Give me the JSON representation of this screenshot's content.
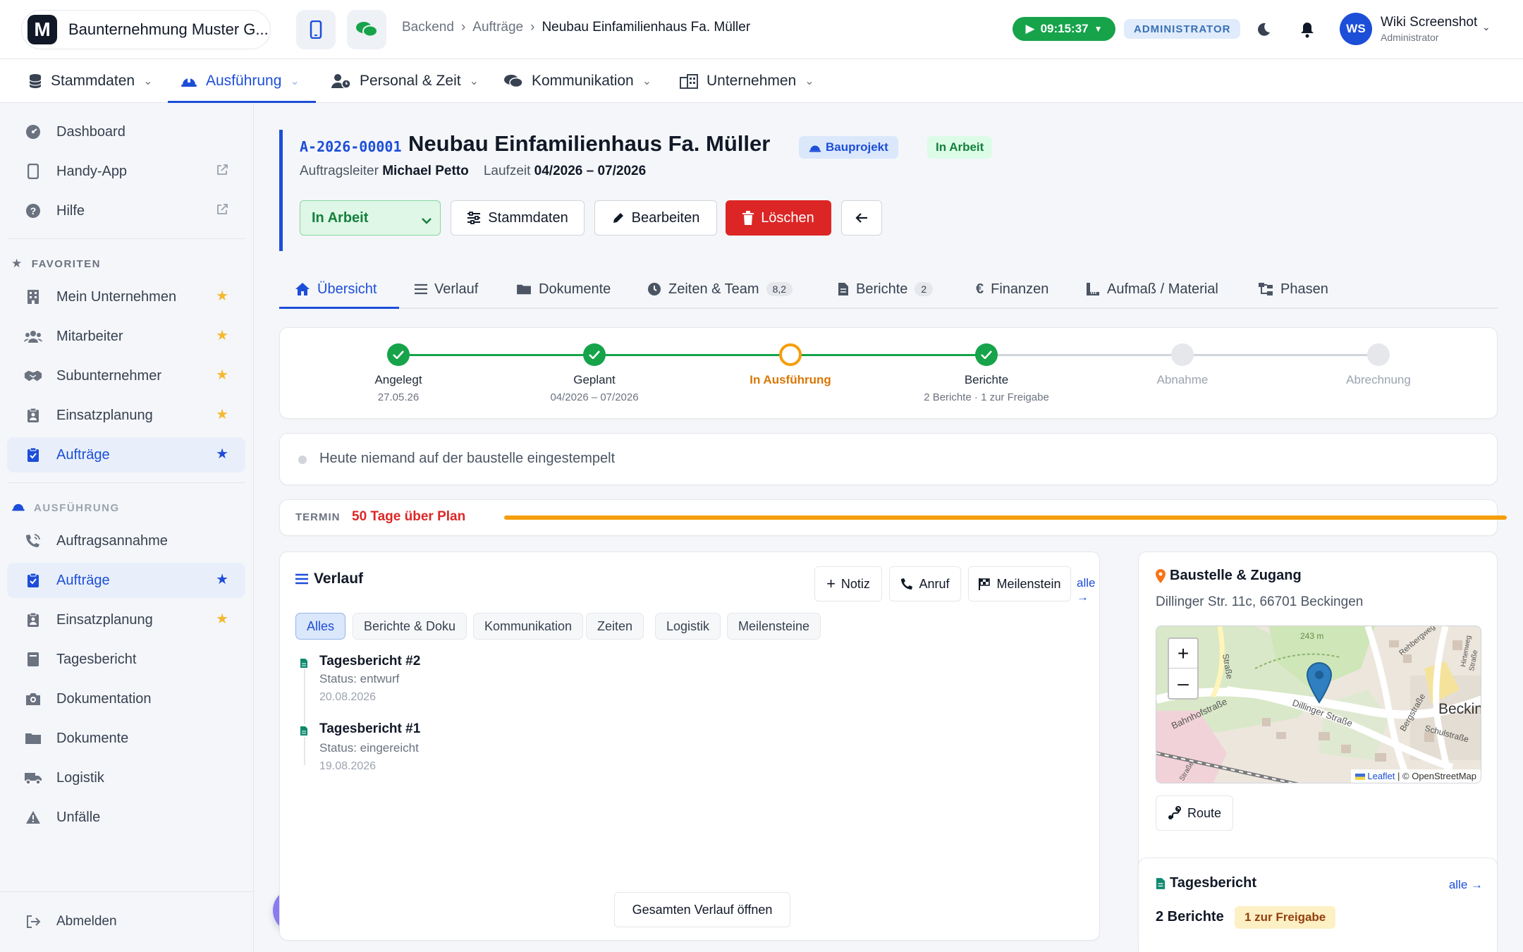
{
  "header": {
    "company_logo": "M",
    "company_name": "Baunternehmung Muster G...",
    "breadcrumb": [
      "Backend",
      "Aufträge",
      "Neubau Einfamilienhaus Fa. Müller"
    ],
    "timer": "09:15:37",
    "role": "ADMINISTRATOR",
    "user_initials": "WS",
    "user_name": "Wiki Screenshot",
    "user_role": "Administrator"
  },
  "mainnav": [
    {
      "label": "Stammdaten",
      "icon": "database-icon"
    },
    {
      "label": "Ausführung",
      "icon": "hardhat-icon",
      "active": true
    },
    {
      "label": "Personal & Zeit",
      "icon": "user-clock-icon"
    },
    {
      "label": "Kommunikation",
      "icon": "comments-icon"
    },
    {
      "label": "Unternehmen",
      "icon": "building-icon"
    }
  ],
  "sidebar": {
    "top": [
      {
        "label": "Dashboard",
        "icon": "gauge-icon"
      },
      {
        "label": "Handy-App",
        "icon": "phone-icon",
        "external": true
      },
      {
        "label": "Hilfe",
        "icon": "help-icon",
        "external": true
      }
    ],
    "favorites_title": "FAVORITEN",
    "favorites": [
      {
        "label": "Mein Unternehmen",
        "icon": "building-icon"
      },
      {
        "label": "Mitarbeiter",
        "icon": "users-icon"
      },
      {
        "label": "Subunternehmer",
        "icon": "handshake-icon"
      },
      {
        "label": "Einsatzplanung",
        "icon": "clipboard-icon"
      },
      {
        "label": "Aufträge",
        "icon": "clipboard-check-icon",
        "active": true
      }
    ],
    "execution_title": "AUSFÜHRUNG",
    "execution": [
      {
        "label": "Auftragsannahme",
        "icon": "phone-volume-icon"
      },
      {
        "label": "Aufträge",
        "icon": "clipboard-check-icon",
        "active": true,
        "star": true
      },
      {
        "label": "Einsatzplanung",
        "icon": "clipboard-icon",
        "star": true
      },
      {
        "label": "Tagesbericht",
        "icon": "book-icon"
      },
      {
        "label": "Dokumentation",
        "icon": "camera-icon"
      },
      {
        "label": "Dokumente",
        "icon": "folder-icon"
      },
      {
        "label": "Logistik",
        "icon": "truck-icon"
      },
      {
        "label": "Unfälle",
        "icon": "warning-icon"
      }
    ],
    "logout": "Abmelden"
  },
  "order": {
    "number": "A-2026-00001",
    "title": "Neubau Einfamilienhaus Fa. Müller",
    "type_badge": "Bauprojekt",
    "status_badge": "In Arbeit",
    "leader_label": "Auftragsleiter",
    "leader": "Michael Petto",
    "duration_label": "Laufzeit",
    "duration": "04/2026 – 07/2026",
    "status_select": "In Arbeit",
    "btn_master": "Stammdaten",
    "btn_edit": "Bearbeiten",
    "btn_delete": "Löschen"
  },
  "tabs": [
    {
      "label": "Übersicht",
      "icon": "home-icon",
      "active": true
    },
    {
      "label": "Verlauf",
      "icon": "list-icon"
    },
    {
      "label": "Dokumente",
      "icon": "folder-icon"
    },
    {
      "label": "Zeiten & Team",
      "icon": "clock-icon",
      "count": "8,2"
    },
    {
      "label": "Berichte",
      "icon": "file-icon",
      "count": "2"
    },
    {
      "label": "Finanzen",
      "icon": "euro-icon"
    },
    {
      "label": "Aufmaß / Material",
      "icon": "ruler-icon"
    },
    {
      "label": "Phasen",
      "icon": "sitemap-icon"
    }
  ],
  "progress": [
    {
      "label": "Angelegt",
      "sub": "27.05.26",
      "state": "done"
    },
    {
      "label": "Geplant",
      "sub": "04/2026 – 07/2026",
      "state": "done"
    },
    {
      "label": "In Ausführung",
      "sub": "",
      "state": "current"
    },
    {
      "label": "Berichte",
      "sub": "2 Berichte · 1 zur Freigabe",
      "state": "done"
    },
    {
      "label": "Abnahme",
      "sub": "",
      "state": "pending"
    },
    {
      "label": "Abrechnung",
      "sub": "",
      "state": "pending"
    }
  ],
  "clockin": "Heute niemand auf der baustelle eingestempelt",
  "termin": {
    "label": "TERMIN",
    "text": "50 Tage über Plan",
    "fill": 1.0
  },
  "verlauf": {
    "title": "Verlauf",
    "btn_note": "Notiz",
    "btn_call": "Anruf",
    "btn_milestone": "Meilenstein",
    "all_link": "alle →",
    "filters": [
      "Alles",
      "Berichte & Doku",
      "Kommunikation",
      "Zeiten",
      "Logistik",
      "Meilensteine"
    ],
    "entries": [
      {
        "title": "Tagesbericht #2",
        "status": "Status: entwurf",
        "date": "20.08.2026"
      },
      {
        "title": "Tagesbericht #1",
        "status": "Status: eingereicht",
        "date": "19.08.2026"
      }
    ],
    "open_all": "Gesamten Verlauf öffnen"
  },
  "site": {
    "title": "Baustelle & Zugang",
    "address": "Dillinger Str. 11c, 66701 Beckingen",
    "map_labels": {
      "streets": [
        "Bahnhofstraße",
        "Dillinger Straße",
        "Bergstraße",
        "Schulstraße",
        "Rehbergweg",
        "Hirtenweg",
        "Straße",
        "Straße",
        "Straße"
      ],
      "town": "Becking",
      "elevation": "243 m"
    },
    "attrib_leaflet": "Leaflet",
    "attrib_osm": "| © OpenStreetMap",
    "zoom_in": "+",
    "zoom_out": "–",
    "route_btn": "Route"
  },
  "dailyreport": {
    "title": "Tagesbericht",
    "all_link": "alle →",
    "count": "2 Berichte",
    "approval_badge": "1 zur Freigabe"
  },
  "colors": {
    "primary": "#1d4ed8",
    "success": "#16a34a",
    "warning": "#f59e0b",
    "danger": "#dc2626"
  }
}
